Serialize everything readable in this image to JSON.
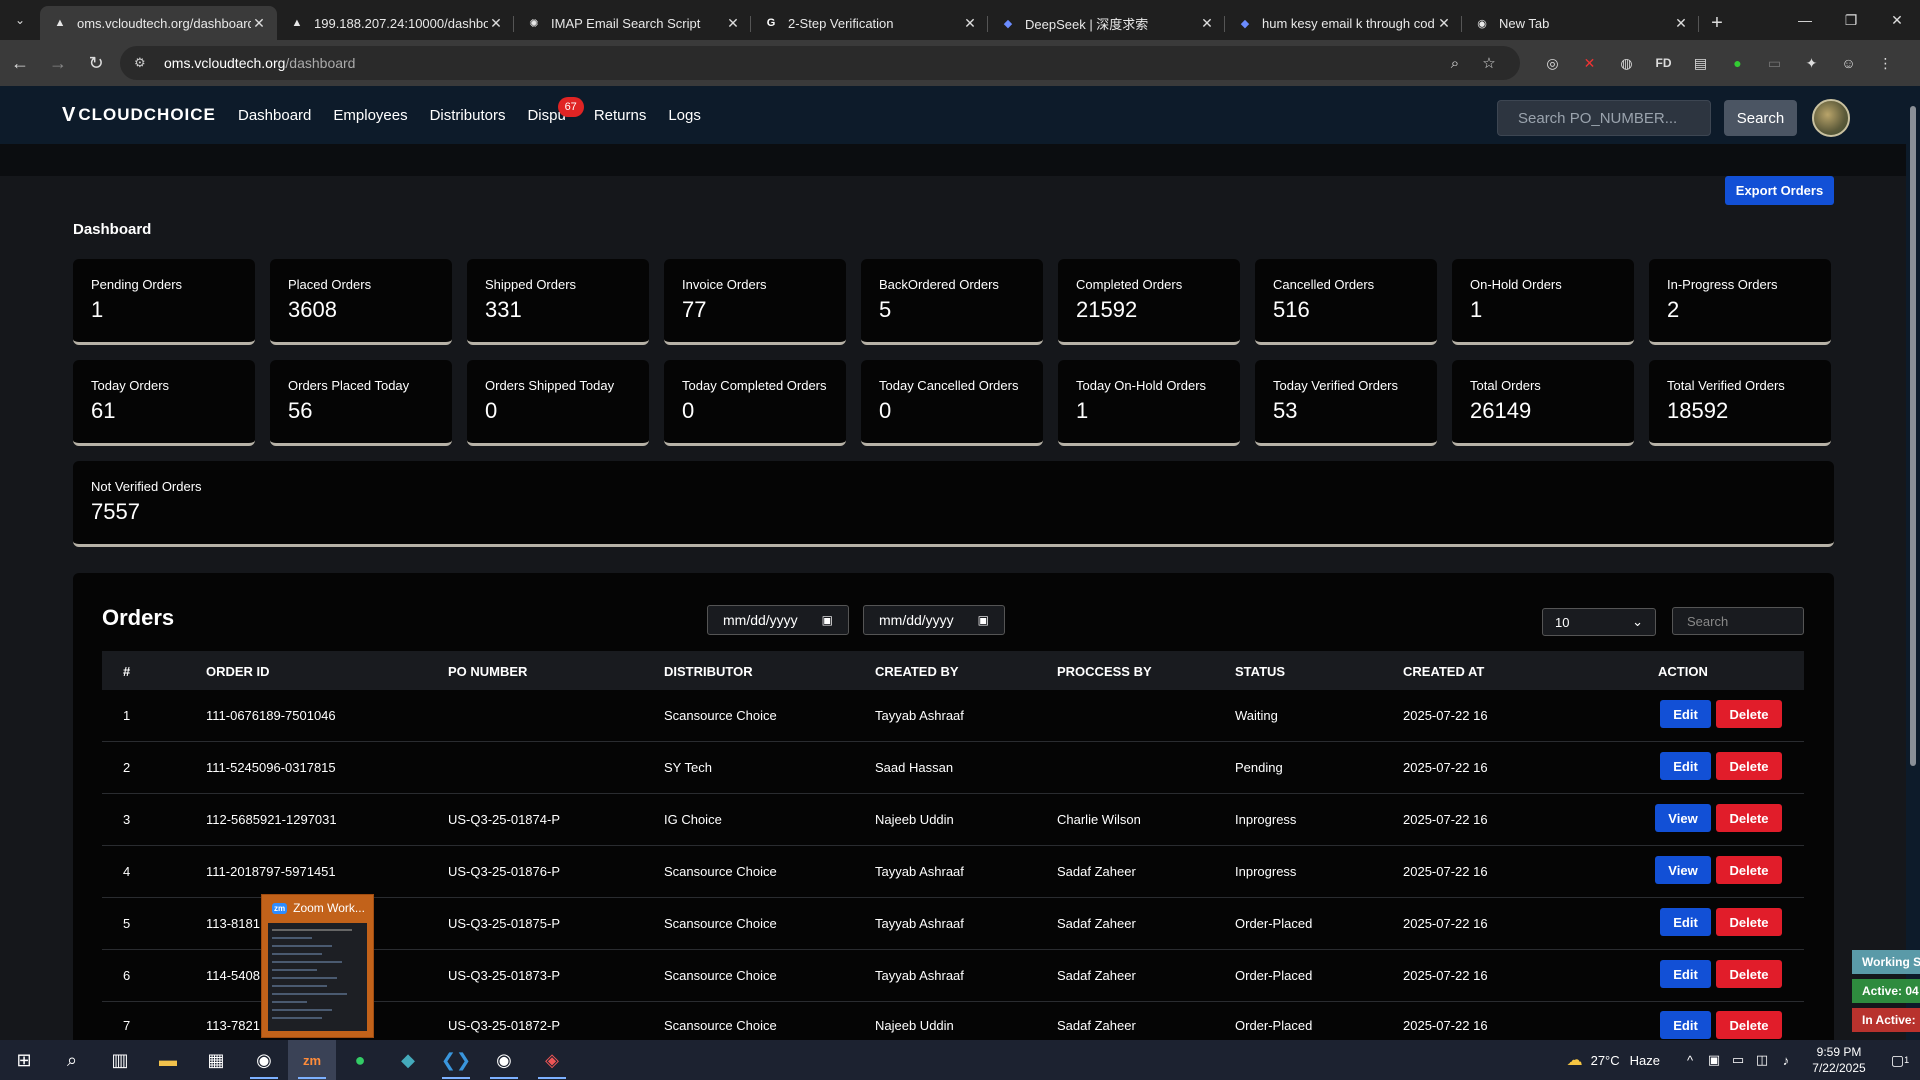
{
  "browser": {
    "tabs": [
      {
        "title": "oms.vcloudtech.org/dashboard",
        "icon": "triangle-icon",
        "active": true
      },
      {
        "title": "199.188.207.24:10000/dashboa",
        "icon": "triangle-icon",
        "active": false
      },
      {
        "title": "IMAP Email Search Script",
        "icon": "openai-icon",
        "active": false
      },
      {
        "title": "2-Step Verification",
        "icon": "google-icon",
        "active": false
      },
      {
        "title": "DeepSeek | 深度求索",
        "icon": "deepseek-icon",
        "active": false
      },
      {
        "title": "hum kesy email k through cod",
        "icon": "deepseek-icon",
        "active": false
      },
      {
        "title": "New Tab",
        "icon": "chrome-icon",
        "active": false
      }
    ],
    "url_host": "oms.vcloudtech.org",
    "url_path": "/dashboard"
  },
  "app": {
    "logo": "CLOUDCHOICE",
    "nav": [
      "Dashboard",
      "Employees",
      "Distributors",
      "Dispu",
      "Returns",
      "Logs"
    ],
    "disputes_badge": "67",
    "search_placeholder": "Search PO_NUMBER...",
    "search_button": "Search"
  },
  "dashboard": {
    "export_label": "Export Orders",
    "title": "Dashboard",
    "row1": [
      {
        "label": "Pending Orders",
        "value": "1"
      },
      {
        "label": "Placed Orders",
        "value": "3608"
      },
      {
        "label": "Shipped Orders",
        "value": "331"
      },
      {
        "label": "Invoice Orders",
        "value": "77"
      },
      {
        "label": "BackOrdered Orders",
        "value": "5"
      },
      {
        "label": "Completed Orders",
        "value": "21592"
      },
      {
        "label": "Cancelled Orders",
        "value": "516"
      },
      {
        "label": "On-Hold Orders",
        "value": "1"
      },
      {
        "label": "In-Progress Orders",
        "value": "2"
      }
    ],
    "row2": [
      {
        "label": "Today Orders",
        "value": "61"
      },
      {
        "label": "Orders Placed Today",
        "value": "56"
      },
      {
        "label": "Orders Shipped Today",
        "value": "0"
      },
      {
        "label": "Today Completed Orders",
        "value": "0"
      },
      {
        "label": "Today Cancelled Orders",
        "value": "0"
      },
      {
        "label": "Today On-Hold Orders",
        "value": "1"
      },
      {
        "label": "Today Verified Orders",
        "value": "53"
      },
      {
        "label": "Total Orders",
        "value": "26149"
      },
      {
        "label": "Total Verified Orders",
        "value": "18592"
      }
    ],
    "not_verified": {
      "label": "Not Verified Orders",
      "value": "7557"
    }
  },
  "orders": {
    "title": "Orders",
    "date_from_placeholder": "mm/dd/yyyy",
    "date_to_placeholder": "mm/dd/yyyy",
    "per_page": "10",
    "search_placeholder": "Search",
    "columns": [
      "#",
      "ORDER ID",
      "PO NUMBER",
      "DISTRIBUTOR",
      "CREATED BY",
      "PROCCESS BY",
      "STATUS",
      "CREATED AT",
      "ACTION"
    ],
    "rows": [
      {
        "n": "1",
        "order_id": "111-0676189-7501046",
        "po": "",
        "distributor": "Scansource Choice",
        "created_by": "Tayyab Ashraaf",
        "process_by": "",
        "status": "Waiting",
        "created_at": "2025-07-22 16",
        "action": "Edit",
        "delete": "Delete"
      },
      {
        "n": "2",
        "order_id": "111-5245096-0317815",
        "po": "",
        "distributor": "SY Tech",
        "created_by": "Saad Hassan",
        "process_by": "",
        "status": "Pending",
        "created_at": "2025-07-22 16",
        "action": "Edit",
        "delete": "Delete"
      },
      {
        "n": "3",
        "order_id": "112-5685921-1297031",
        "po": "US-Q3-25-01874-P",
        "distributor": "IG Choice",
        "created_by": "Najeeb Uddin",
        "process_by": "Charlie Wilson",
        "status": "Inprogress",
        "created_at": "2025-07-22 16",
        "action": "View",
        "delete": "Delete"
      },
      {
        "n": "4",
        "order_id": "111-2018797-5971451",
        "po": "US-Q3-25-01876-P",
        "distributor": "Scansource Choice",
        "created_by": "Tayyab Ashraaf",
        "process_by": "Sadaf Zaheer",
        "status": "Inprogress",
        "created_at": "2025-07-22 16",
        "action": "View",
        "delete": "Delete"
      },
      {
        "n": "5",
        "order_id": "113-8181",
        "po": "US-Q3-25-01875-P",
        "distributor": "Scansource Choice",
        "created_by": "Tayyab Ashraaf",
        "process_by": "Sadaf Zaheer",
        "status": "Order-Placed",
        "created_at": "2025-07-22 16",
        "action": "Edit",
        "delete": "Delete"
      },
      {
        "n": "6",
        "order_id": "114-5408",
        "po": "US-Q3-25-01873-P",
        "distributor": "Scansource Choice",
        "created_by": "Tayyab Ashraaf",
        "process_by": "Sadaf Zaheer",
        "status": "Order-Placed",
        "created_at": "2025-07-22 16",
        "action": "Edit",
        "delete": "Delete"
      },
      {
        "n": "7",
        "order_id": "113-7821",
        "po": "US-Q3-25-01872-P",
        "distributor": "Scansource Choice",
        "created_by": "Najeeb Uddin",
        "process_by": "Sadaf Zaheer",
        "status": "Order-Placed",
        "created_at": "2025-07-22 16",
        "action": "Edit",
        "delete": "Delete"
      }
    ]
  },
  "zoom_popup": {
    "title": "Zoom Work..."
  },
  "side_status": [
    {
      "text": "Working S",
      "color": "#5a9aa8"
    },
    {
      "text": "Active: 04",
      "color": "#2e8b3e"
    },
    {
      "text": "In Active:",
      "color": "#b8322d"
    }
  ],
  "taskbar": {
    "temperature": "27°C",
    "weather": "Haze",
    "time": "9:59 PM",
    "date": "7/22/2025",
    "notification_count": "1"
  },
  "colors": {
    "primary_button": "#1250d6",
    "danger_button": "#e11d2a",
    "navbar": "#0d1b2a",
    "badge": "#e02424"
  }
}
